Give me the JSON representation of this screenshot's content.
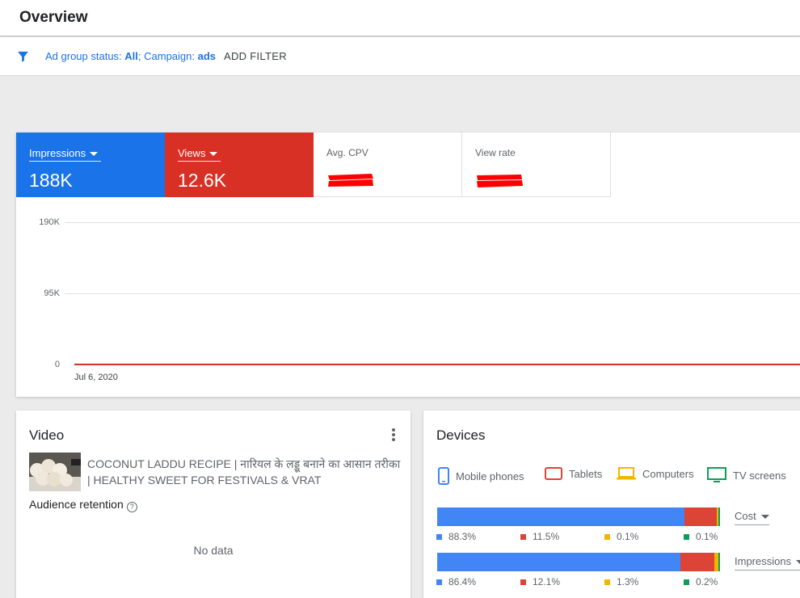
{
  "header": {
    "title": "Overview"
  },
  "filter": {
    "prefix1": "Ad group status: ",
    "value1": "All",
    "prefix2": "; Campaign: ",
    "value2": "ads",
    "add_filter_label": "ADD FILTER",
    "accent_color": "#1a73e8"
  },
  "metrics": [
    {
      "label": "Impressions",
      "value": "188K",
      "color": "#1a73e8"
    },
    {
      "label": "Views",
      "value": "12.6K",
      "color": "#d93025"
    },
    {
      "label": "Avg. CPV",
      "value": ""
    },
    {
      "label": "View rate",
      "value": ""
    }
  ],
  "chart_data": {
    "type": "line",
    "x": [
      "Jul 6, 2020"
    ],
    "series": [
      {
        "name": "Views",
        "values": [
          0
        ],
        "color": "#d93025"
      }
    ],
    "yticks": [
      "190K",
      "95K",
      "0"
    ],
    "ylim": [
      0,
      190000
    ],
    "grid": true
  },
  "video": {
    "title": "Video",
    "video_title": "COCONUT LADDU RECIPE | नारियल के लड्डू बनाने का आसान तरीका | HEALTHY SWEET FOR FESTIVALS & VRAT",
    "retention_label": "Audience retention",
    "help_glyph": "?",
    "no_data": "No data"
  },
  "devices": {
    "title": "Devices",
    "legend": [
      {
        "label": "Mobile phones",
        "icon": "mobile-phone-icon",
        "color": "#4285f4"
      },
      {
        "label": "Tablets",
        "icon": "tablet-icon",
        "color": "#db4437"
      },
      {
        "label": "Computers",
        "icon": "computer-icon",
        "color": "#f4b400"
      },
      {
        "label": "TV screens",
        "icon": "tv-screen-icon",
        "color": "#0f9d58"
      }
    ],
    "rows": [
      {
        "metric": "Cost",
        "values": [
          88.3,
          11.5,
          0.1,
          0.1
        ],
        "labels": [
          "88.3%",
          "11.5%",
          "0.1%",
          "0.1%"
        ]
      },
      {
        "metric": "Impressions",
        "values": [
          86.4,
          12.1,
          1.3,
          0.2
        ],
        "labels": [
          "86.4%",
          "12.1%",
          "1.3%",
          "0.2%"
        ]
      }
    ]
  }
}
